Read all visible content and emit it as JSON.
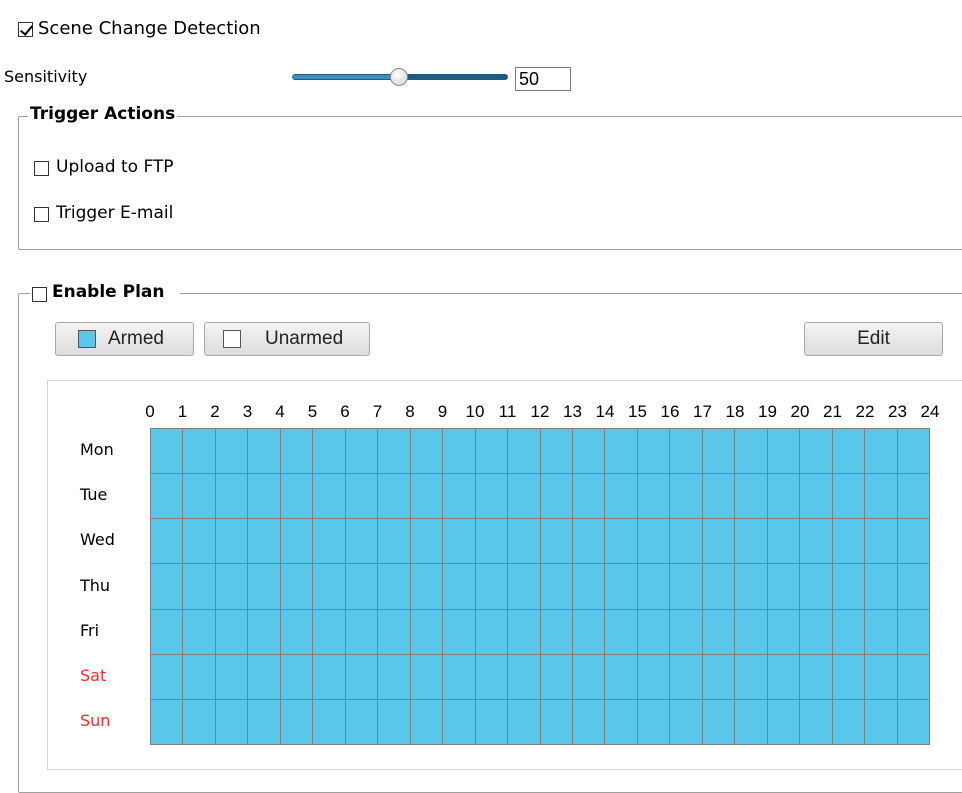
{
  "scene_change": {
    "label": "Scene Change Detection",
    "checked": true
  },
  "sensitivity": {
    "label": "Sensitivity",
    "value": "50",
    "level": 50
  },
  "trigger_actions": {
    "title": "Trigger Actions",
    "upload_ftp": {
      "label": "Upload to FTP",
      "checked": false
    },
    "trigger_email": {
      "label": "Trigger E-mail",
      "checked": false
    }
  },
  "plan": {
    "title": "Enable Plan",
    "enabled": false,
    "armed_label": "Armed",
    "unarmed_label": "Unarmed",
    "edit_label": "Edit",
    "hours": [
      "0",
      "1",
      "2",
      "3",
      "4",
      "5",
      "6",
      "7",
      "8",
      "9",
      "10",
      "11",
      "12",
      "13",
      "14",
      "15",
      "16",
      "17",
      "18",
      "19",
      "20",
      "21",
      "22",
      "23",
      "24"
    ],
    "days": [
      "Mon",
      "Tue",
      "Wed",
      "Thu",
      "Fri",
      "Sat",
      "Sun"
    ],
    "weekend_days": [
      "Sat",
      "Sun"
    ],
    "all_armed": true
  },
  "colors": {
    "armed": "#58c7ea",
    "unarmed": "#ffffff",
    "weekend_text": "#ff2a2a",
    "slider_fill": "#2a7aa8",
    "slider_track": "#1d5c83"
  }
}
